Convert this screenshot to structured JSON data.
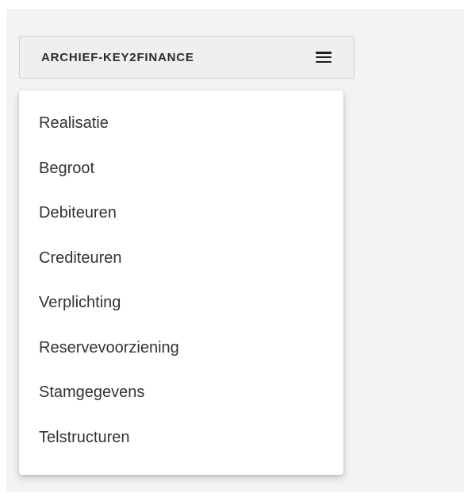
{
  "menu_button": {
    "label": "ARCHIEF-KEY2FINANCE",
    "icon": "hamburger-icon"
  },
  "dropdown": {
    "items": [
      {
        "label": "Realisatie"
      },
      {
        "label": "Begroot"
      },
      {
        "label": "Debiteuren"
      },
      {
        "label": "Crediteuren"
      },
      {
        "label": "Verplichting"
      },
      {
        "label": "Reservevoorziening"
      },
      {
        "label": "Stamgegevens"
      },
      {
        "label": "Telstructuren"
      }
    ]
  },
  "colors": {
    "background_panel": "#f3f3f3",
    "button_background": "#efefef",
    "button_border": "#d0d0d0",
    "text": "#333333",
    "dropdown_background": "#ffffff"
  }
}
